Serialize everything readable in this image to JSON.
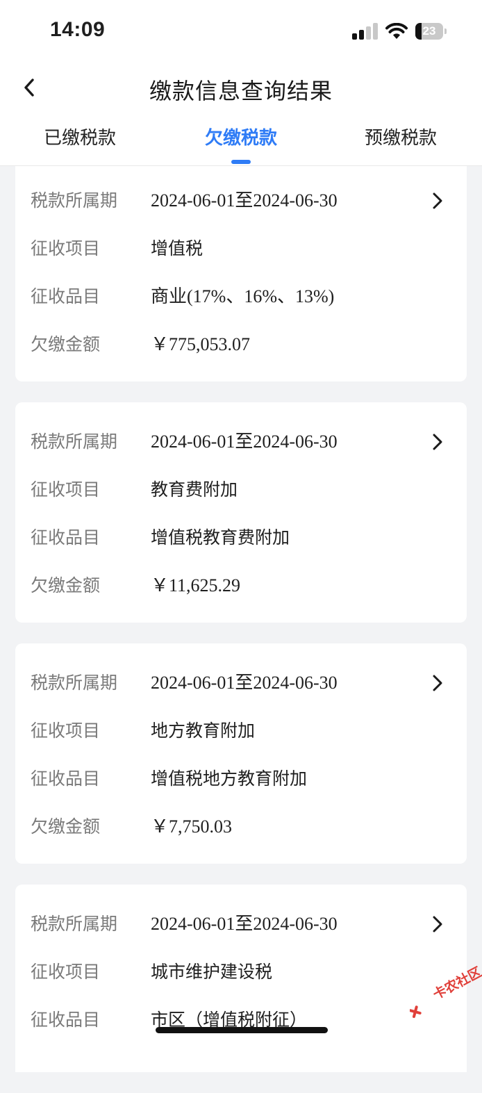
{
  "status_bar": {
    "time": "14:09",
    "battery_level": "23",
    "icons": [
      "cellular-signal-icon",
      "wifi-icon",
      "battery-icon"
    ]
  },
  "nav": {
    "title": "缴款信息查询结果",
    "back_icon": "chevron-left-icon"
  },
  "tabs": [
    {
      "label": "已缴税款",
      "active": false
    },
    {
      "label": "欠缴税款",
      "active": true
    },
    {
      "label": "预缴税款",
      "active": false
    }
  ],
  "colors": {
    "accent": "#2f7cf6",
    "background": "#f2f3f5",
    "label_text": "#7a7a7a"
  },
  "records": [
    {
      "period_label": "税款所属期",
      "period": "2024-06-01至2024-06-30",
      "item_label": "征收项目",
      "item": "增值税",
      "category_label": "征收品目",
      "category": "商业(17%、16%、13%)",
      "amount_label": "欠缴金额",
      "amount": "￥775,053.07"
    },
    {
      "period_label": "税款所属期",
      "period": "2024-06-01至2024-06-30",
      "item_label": "征收项目",
      "item": "教育费附加",
      "category_label": "征收品目",
      "category": "增值税教育费附加",
      "amount_label": "欠缴金额",
      "amount": "￥11,625.29"
    },
    {
      "period_label": "税款所属期",
      "period": "2024-06-01至2024-06-30",
      "item_label": "征收项目",
      "item": "地方教育附加",
      "category_label": "征收品目",
      "category": "增值税地方教育附加",
      "amount_label": "欠缴金额",
      "amount": "￥7,750.03"
    },
    {
      "period_label": "税款所属期",
      "period": "2024-06-01至2024-06-30",
      "item_label": "征收项目",
      "item": "城市维护建设税",
      "category_label": "征收品目",
      "category": "市区（增值税附征）"
    }
  ],
  "watermark": {
    "text": "卡农社区"
  }
}
